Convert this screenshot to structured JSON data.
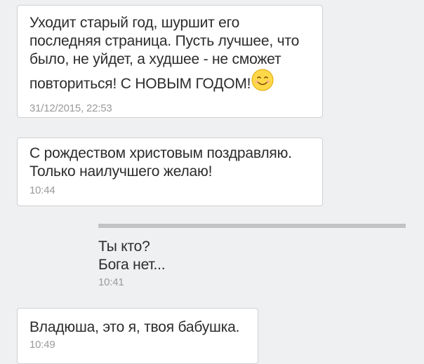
{
  "messages": [
    {
      "text": "Уходит старый год, шуршит его последняя страница. Пусть лучшее, что было, не уйдет, а худшее - не сможет повториться! С НОВЫМ ГОДОМ!",
      "emoji": "smiling-face-emoji",
      "time": "31/12/2015, 22:53"
    },
    {
      "line1": "С рождеством христовым поздравляю.",
      "line2": "Только наилучшего желаю!",
      "time": "10:44"
    },
    {
      "line1": "Ты кто?",
      "line2": "Бога нет...",
      "time": "10:41",
      "outgoing": true
    },
    {
      "text": "Владюша, это я, твоя бабушка.",
      "time": "10:49"
    }
  ],
  "colors": {
    "background": "#eff0f1",
    "bubble": "#ffffff",
    "bubble_border": "#cfd0d2",
    "outgoing_bar": "#c2c3c5",
    "text": "#2c2c2c",
    "timestamp": "#9a9a9a",
    "emoji_face": "#ffd84a"
  }
}
